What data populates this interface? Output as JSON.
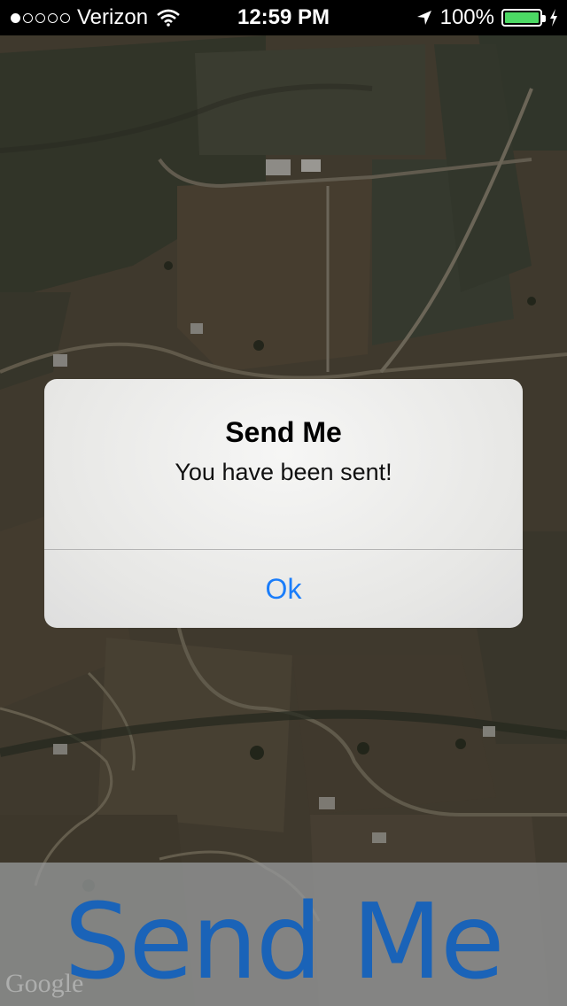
{
  "status_bar": {
    "signal_bars_filled": 1,
    "signal_bars_total": 5,
    "carrier": "Verizon",
    "time": "12:59 PM",
    "battery": "100%",
    "icons": [
      "wifi-icon",
      "location-arrow-icon",
      "battery-icon",
      "charging-bolt-icon"
    ]
  },
  "map": {
    "type": "satellite",
    "watermark": "Google"
  },
  "alert": {
    "title": "Send Me",
    "message": "You have been sent!",
    "button_label": "Ok"
  },
  "bottom_bar": {
    "button_label": "Send Me"
  },
  "colors": {
    "accent": "#1a7dfa",
    "send_text": "#1a63b8",
    "battery": "#4cd964"
  }
}
